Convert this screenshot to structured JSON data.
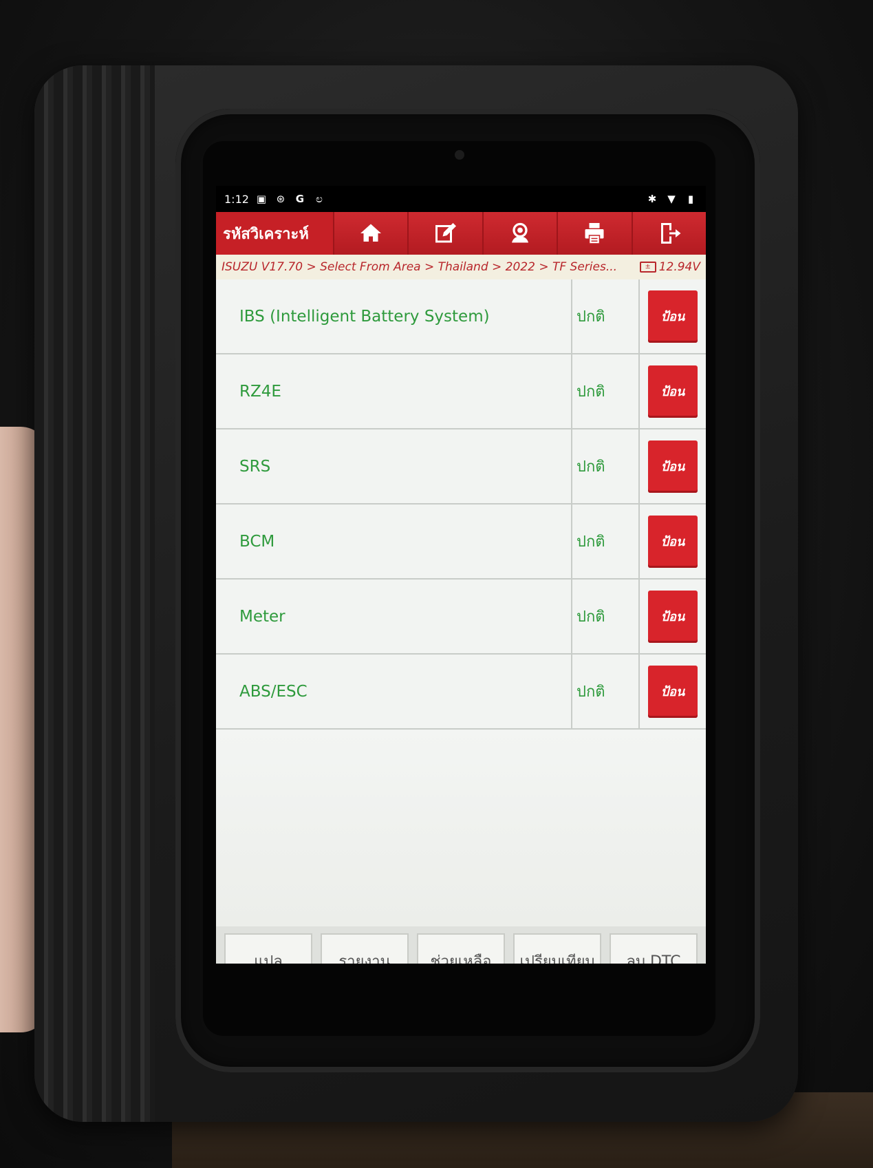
{
  "status_bar": {
    "time": "1:12",
    "left_icons": [
      "photo-icon",
      "settings-sync-icon",
      "google-icon",
      "diagnostic-icon"
    ],
    "right_icons": [
      "bluetooth-icon",
      "wifi-icon",
      "battery-icon"
    ]
  },
  "app_bar": {
    "title": "รหัสวิเคราะห์",
    "buttons": [
      {
        "name": "home-icon"
      },
      {
        "name": "edit-icon"
      },
      {
        "name": "support-icon"
      },
      {
        "name": "print-icon"
      },
      {
        "name": "exit-icon"
      }
    ]
  },
  "breadcrumb": {
    "path": "ISUZU V17.70 > Select From Area > Thailand > 2022 > TF Series...",
    "voltage": "12.94V"
  },
  "systems": [
    {
      "name": "IBS (Intelligent Battery System)",
      "status": "ปกติ",
      "action": "ป้อน"
    },
    {
      "name": "RZ4E",
      "status": "ปกติ",
      "action": "ป้อน"
    },
    {
      "name": "SRS",
      "status": "ปกติ",
      "action": "ป้อน"
    },
    {
      "name": "BCM",
      "status": "ปกติ",
      "action": "ป้อน"
    },
    {
      "name": "Meter",
      "status": "ปกติ",
      "action": "ป้อน"
    },
    {
      "name": "ABS/ESC",
      "status": "ปกติ",
      "action": "ป้อน"
    }
  ],
  "bottom_bar": {
    "translate": "แปล",
    "report": "รายงาน",
    "help": "ช่วยเหลือ",
    "compare": "เปรียบเทียบ",
    "clear_dtc": "ลบ DTC"
  },
  "colors": {
    "accent": "#c62026",
    "status_green": "#2e9a3c",
    "breadcrumb_bg": "#f3efe0"
  }
}
